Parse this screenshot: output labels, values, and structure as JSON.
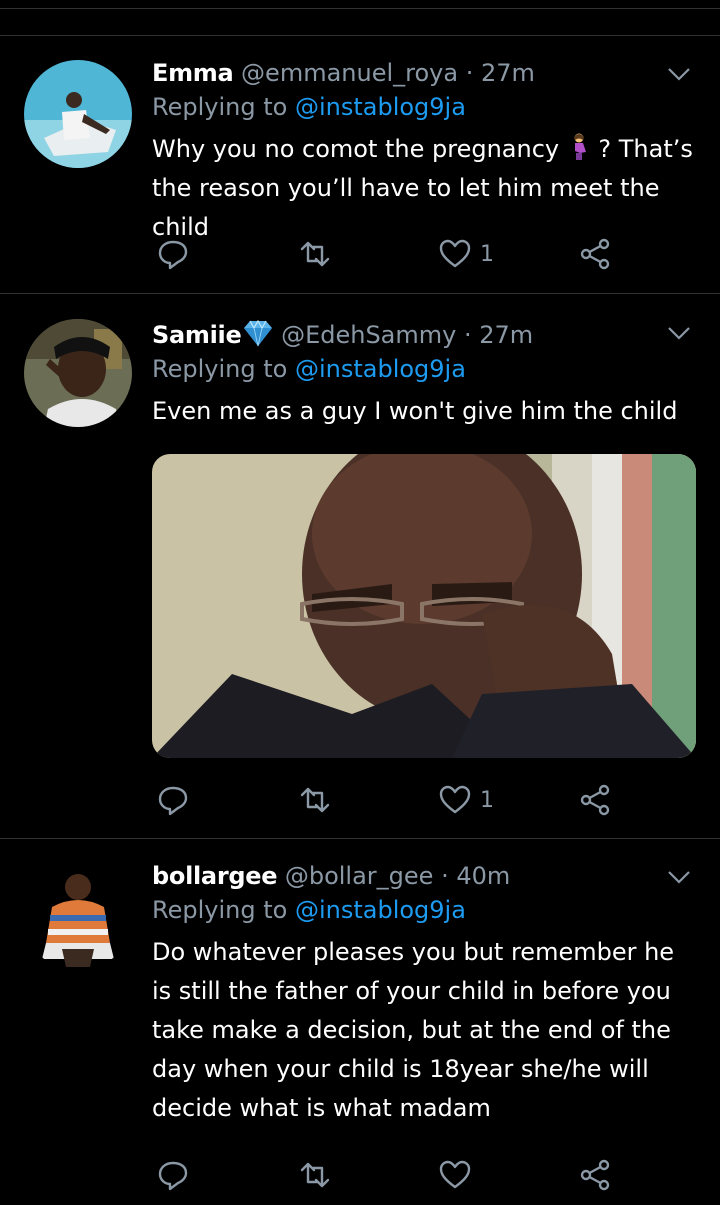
{
  "tweets": [
    {
      "name": "Emma",
      "handle": "@emmanuel_roya",
      "separator": "·",
      "time": "27m",
      "replying_prefix": "Replying to",
      "replying_to": "@instablog9ja",
      "text_before_emoji": "Why you no comot the pregnancy",
      "emoji": "pregnant-woman-emoji",
      "text_after_emoji": "? That’s the reason you’ll have to let him meet the child",
      "likes": "1"
    },
    {
      "name": "Samiie",
      "badge": "gem-emoji",
      "handle": "@EdehSammy",
      "separator": "·",
      "time": "27m",
      "replying_prefix": "Replying to",
      "replying_to": "@instablog9ja",
      "text": "Even me as a guy I won't give him the child",
      "media": "photo",
      "likes": "1"
    },
    {
      "name": "bollargee",
      "handle": "@bollar_gee",
      "separator": "·",
      "time": "40m",
      "replying_prefix": "Replying to",
      "replying_to": "@instablog9ja",
      "text": "Do whatever pleases you but remember he is still the father of your child in before you take make a decision, but at the end of the day when your child is 18year she/he will decide what is what madam",
      "likes": ""
    }
  ],
  "icons": {
    "reply": "reply-icon",
    "retweet": "retweet-icon",
    "like": "heart-icon",
    "share": "share-icon",
    "menu": "chevron-down-icon"
  },
  "colors": {
    "background": "#000000",
    "text": "#ffffff",
    "secondary": "#8b98a5",
    "link": "#1d9bf0",
    "divider": "#2f3336"
  }
}
